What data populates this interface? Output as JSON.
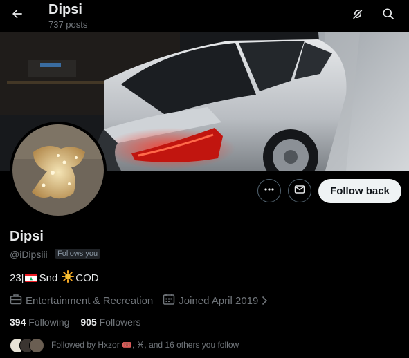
{
  "header": {
    "title": "Dipsi",
    "post_count": "737 posts"
  },
  "icons": {
    "back": "arrow-left-icon",
    "grok": "grok-icon",
    "search": "search-icon",
    "more": "more-dots-icon",
    "message": "envelope-icon",
    "category": "briefcase-icon",
    "joined": "calendar-icon",
    "chevron": "chevron-right-icon"
  },
  "actions": {
    "follow_label": "Follow back"
  },
  "profile": {
    "display_name": "Dipsi",
    "handle": "@iDipsiii",
    "follows_you": "Follows you",
    "bio_start": "23|",
    "bio_mid": " Snd ",
    "bio_end": "COD",
    "category": "Entertainment & Recreation",
    "joined": "Joined April 2019",
    "following_count": "394",
    "following_label": "Following",
    "followers_count": "905",
    "followers_label": "Followers",
    "followed_by_text": "Followed by Hxzor 🎟️, ♓, and 16 others you follow"
  },
  "colors": {
    "background": "#000000",
    "text_primary": "#e7e9ea",
    "text_secondary": "#71767b",
    "button_light": "#eff3f4",
    "taillight_red": "#e0201a"
  }
}
